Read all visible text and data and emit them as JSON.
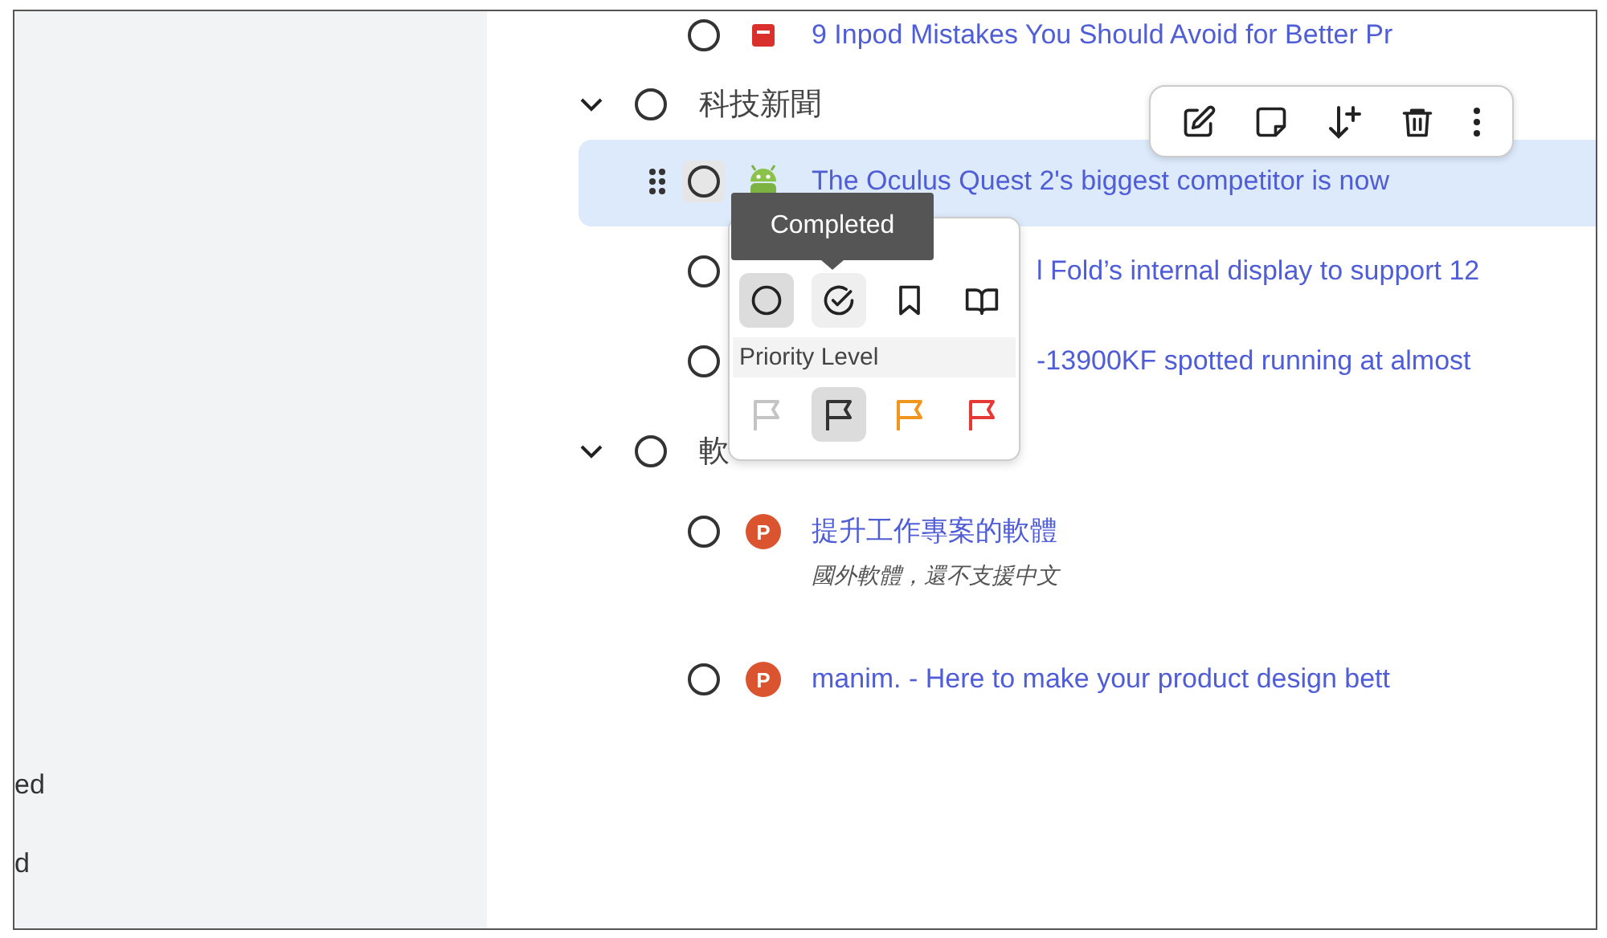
{
  "sidebar": {
    "items": [
      {
        "label": "ed"
      },
      {
        "label": "d"
      }
    ]
  },
  "list": [
    {
      "kind": "item",
      "title": "9 Inpod Mistakes You Should Avoid for Better Pr",
      "checked": false
    },
    {
      "kind": "group",
      "title": "科技新聞",
      "expanded": true,
      "checked": false,
      "children": [
        {
          "kind": "link",
          "title": "The Oculus Quest 2's biggest competitor is now",
          "checked": false,
          "selected": true
        },
        {
          "kind": "partial",
          "title": "l Fold’s internal display to support 12",
          "checked": false,
          "selected": false
        },
        {
          "kind": "partial",
          "title": "-13900KF spotted running at almost",
          "checked": false,
          "selected": false
        }
      ]
    },
    {
      "kind": "group",
      "title": "軟",
      "expanded": true,
      "checked": false,
      "children": [
        {
          "kind": "link",
          "title": "提升工作專案的軟體",
          "badge": "P",
          "note": "國外軟體，還不支援中文",
          "checked": false,
          "selected": false
        },
        {
          "kind": "link",
          "title": "manim. - Here to make your product design bett",
          "badge": "P",
          "checked": false,
          "selected": false
        }
      ]
    }
  ],
  "toolbar": {
    "buttons": [
      {
        "kind": "edit"
      },
      {
        "kind": "note"
      },
      {
        "kind": "sort"
      },
      {
        "kind": "delete"
      },
      {
        "kind": "more"
      }
    ]
  },
  "popup": {
    "tooltip": "Completed",
    "status_options": [
      {
        "kind": "todo",
        "selected": true,
        "hovered": false
      },
      {
        "kind": "done",
        "selected": false,
        "hovered": true
      },
      {
        "kind": "bookmark",
        "selected": false,
        "hovered": false
      },
      {
        "kind": "reading",
        "selected": false,
        "hovered": false
      }
    ],
    "priority_heading": "Priority Level",
    "priority_levels": [
      {
        "color": "#c4c4c4",
        "selected": false
      },
      {
        "color": "#333333",
        "selected": true
      },
      {
        "color": "#f0961e",
        "selected": false
      },
      {
        "color": "#e53935",
        "selected": false
      }
    ]
  }
}
